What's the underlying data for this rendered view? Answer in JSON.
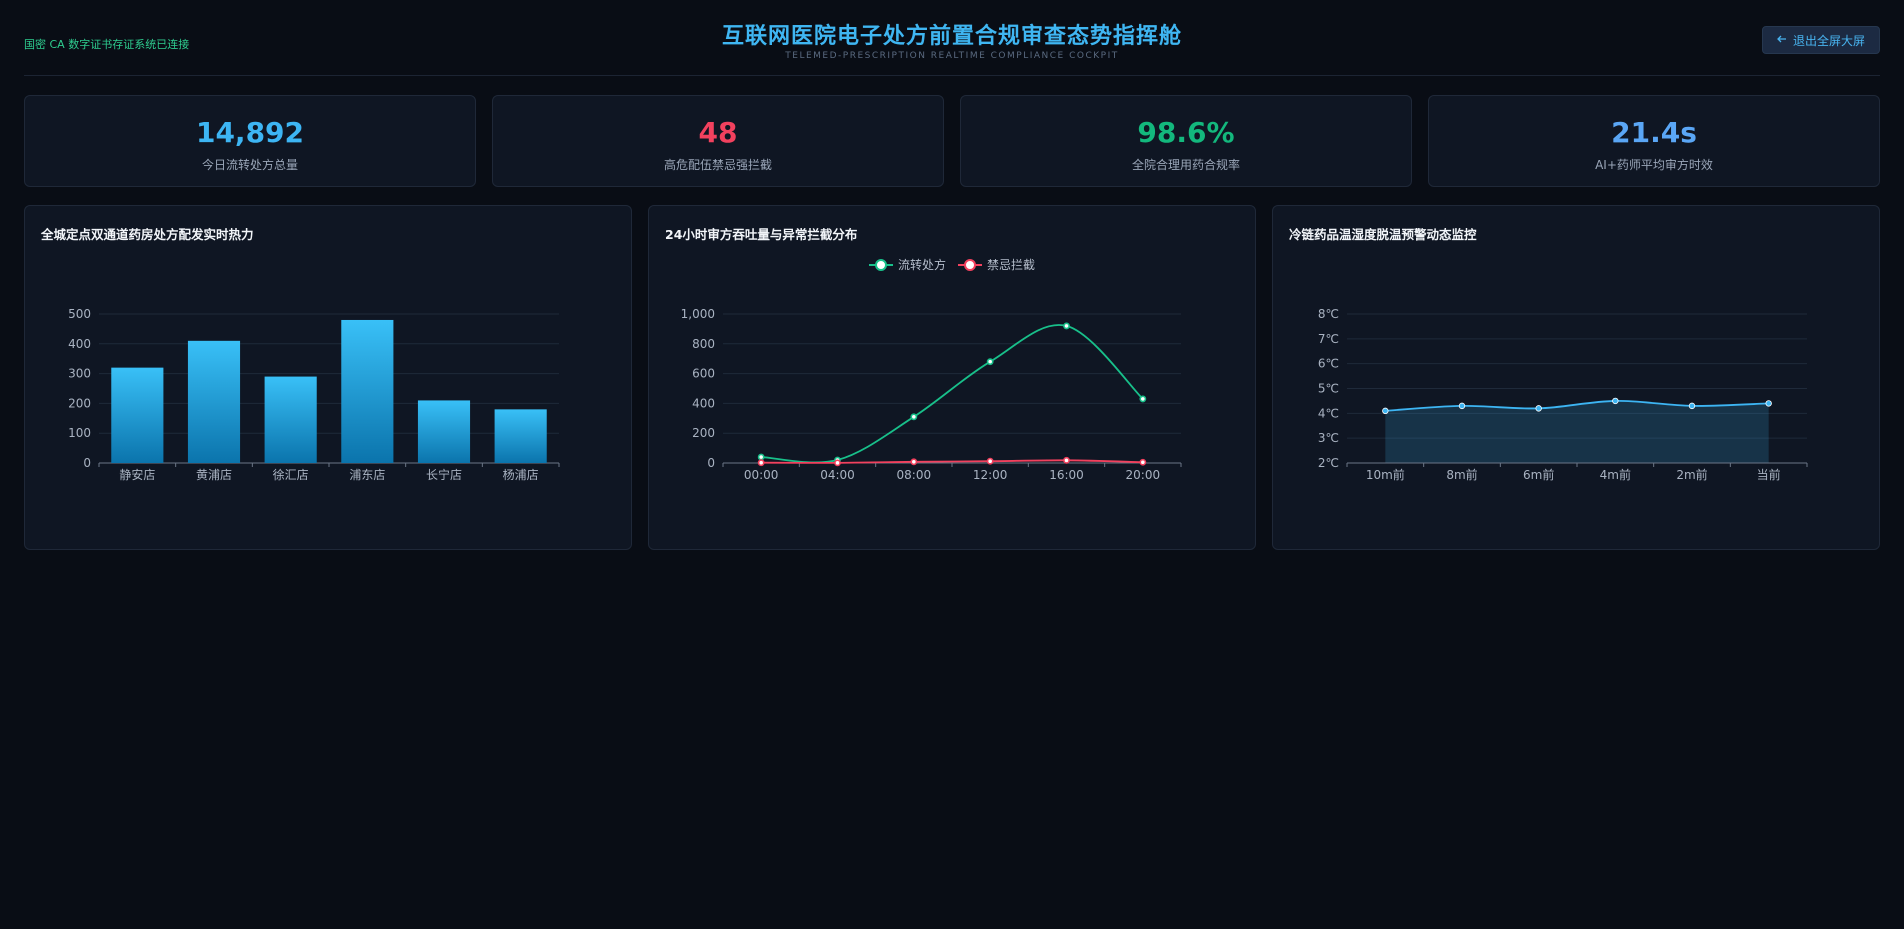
{
  "header": {
    "status_text": "国密 CA 数字证书存证系统已连接",
    "title": "互联网医院电子处方前置合规审查态势指挥舱",
    "subtitle": "TELEMED-PRESCRIPTION REALTIME COMPLIANCE COCKPIT",
    "exit_icon": "arrow-left-icon",
    "exit_label": "退出全屏大屏"
  },
  "kpis": [
    {
      "value": "14,892",
      "label": "今日流转处方总量",
      "color": "#3db5f3"
    },
    {
      "value": "48",
      "label": "高危配伍禁忌强拦截",
      "color": "#f2415e"
    },
    {
      "value": "98.6%",
      "label": "全院合理用药合规率",
      "color": "#13b87d"
    },
    {
      "value": "21.4s",
      "label": "AI+药师平均审方时效",
      "color": "#5aa6f5"
    }
  ],
  "panels": {
    "bar_title": "全城定点双通道药房处方配发实时热力",
    "line_title": "24小时审方吞吐量与异常拦截分布",
    "temp_title": "冷链药品温湿度脱温预警动态监控"
  },
  "chart_data": [
    {
      "type": "bar",
      "title": "全城定点双通道药房处方配发实时热力",
      "categories": [
        "静安店",
        "黄浦店",
        "徐汇店",
        "浦东店",
        "长宁店",
        "杨浦店"
      ],
      "values": [
        320,
        410,
        290,
        480,
        210,
        180
      ],
      "yticks": [
        "0",
        "100",
        "200",
        "300",
        "400",
        "500"
      ],
      "ylim": [
        0,
        500
      ],
      "grid": true,
      "colors": {
        "bar_top": "#39c0f7",
        "bar_bottom": "#0b74ac"
      }
    },
    {
      "type": "line",
      "title": "24小时审方吞吐量与异常拦截分布",
      "x": [
        "00:00",
        "04:00",
        "08:00",
        "12:00",
        "16:00",
        "20:00"
      ],
      "yticks": [
        "0",
        "200",
        "400",
        "600",
        "800",
        "1,000"
      ],
      "ylim": [
        0,
        1000
      ],
      "legend_position": "top-center",
      "series": [
        {
          "name": "流转处方",
          "values": [
            40,
            20,
            310,
            680,
            920,
            430
          ],
          "color": "#18c08a"
        },
        {
          "name": "禁忌拦截",
          "values": [
            2,
            1,
            8,
            12,
            18,
            5
          ],
          "color": "#f2415e"
        }
      ]
    },
    {
      "type": "area",
      "title": "冷链药品温湿度脱温预警动态监控",
      "x": [
        "10m前",
        "8m前",
        "6m前",
        "4m前",
        "2m前",
        "当前"
      ],
      "values": [
        4.1,
        4.3,
        4.2,
        4.5,
        4.3,
        4.4
      ],
      "yticks": [
        "2℃",
        "3℃",
        "4℃",
        "5℃",
        "6℃",
        "7℃",
        "8℃"
      ],
      "ylim": [
        2,
        8
      ],
      "color": "#3db5f3"
    }
  ]
}
